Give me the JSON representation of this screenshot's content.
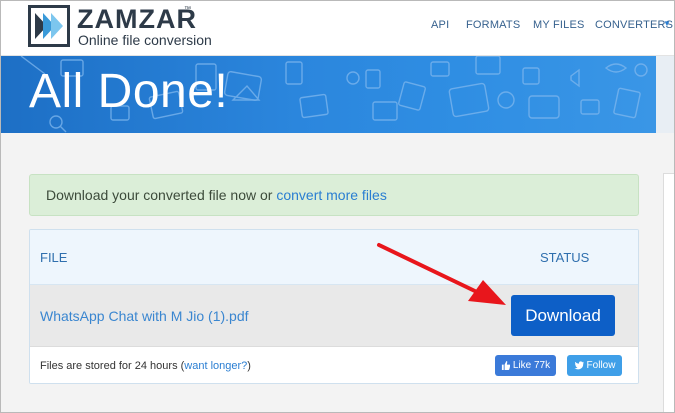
{
  "header": {
    "brand": "ZAMZAR",
    "tm": "™",
    "tagline": "Online file conversion",
    "nav": [
      "API",
      "FORMATS",
      "MY FILES",
      "CONVERTERS"
    ],
    "caret_icon": "caret-down-icon"
  },
  "banner": {
    "title": "All Done!"
  },
  "alert": {
    "text": "Download your converted file now or ",
    "link": "convert more files"
  },
  "table": {
    "headers": {
      "file": "FILE",
      "status": "STATUS"
    },
    "rows": [
      {
        "file": "WhatsApp Chat with M Jio (1).pdf",
        "action": "Download"
      }
    ],
    "footer": {
      "text_before": "Files are stored for 24 hours (",
      "link": "want longer?",
      "text_after": ")",
      "like": "Like 77k",
      "follow": "Follow"
    }
  },
  "colors": {
    "banner": "#2b86dd",
    "download_button": "#0d5fc7",
    "link": "#2a7ed2",
    "alert_bg": "#dbeed8",
    "arrow": "#e8161c"
  }
}
